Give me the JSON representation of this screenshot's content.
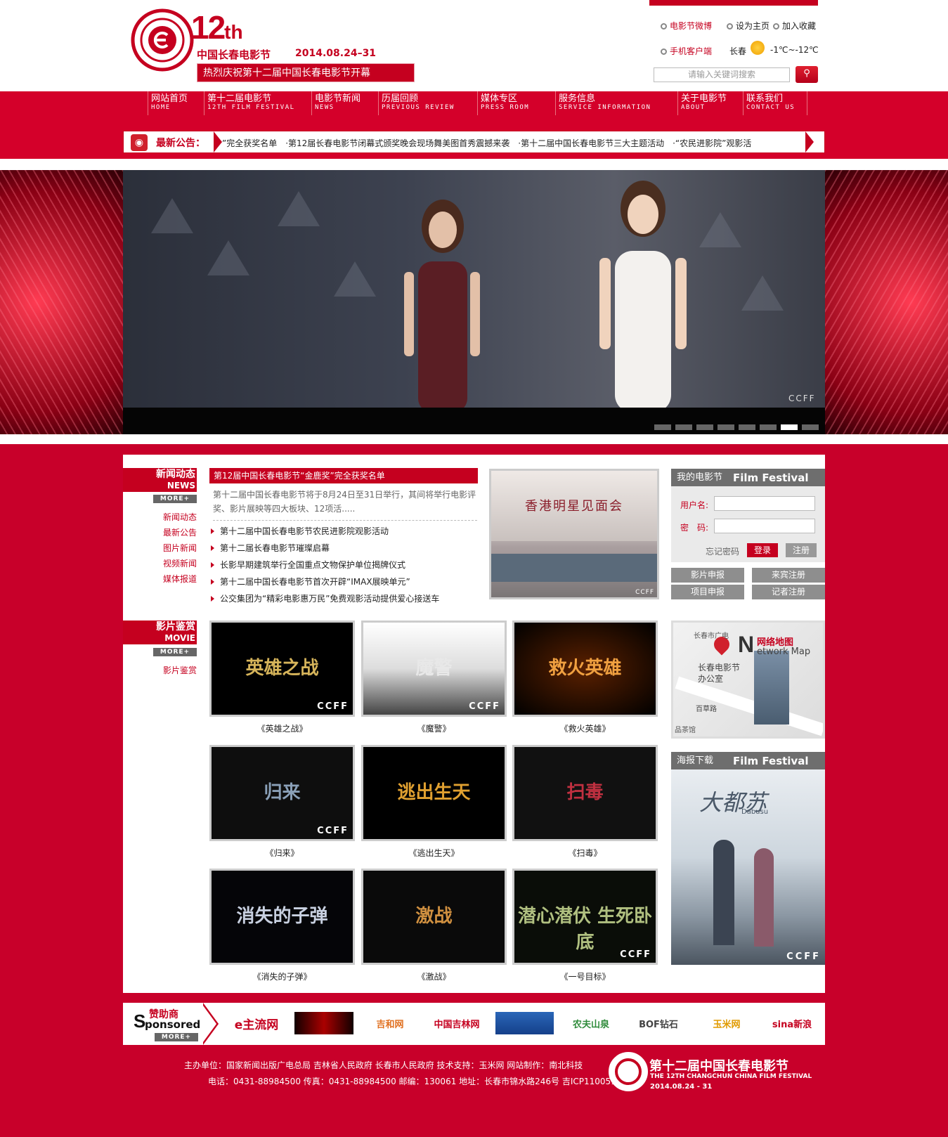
{
  "header": {
    "logo_number": "12",
    "logo_suffix": "th",
    "logo_title": "中国长春电影节",
    "logo_date": "2014.08.24–31",
    "slogan": "热烈庆祝第十二届中国长春电影节开幕",
    "top_links": [
      "电影节微博",
      "设为主页",
      "加入收藏"
    ],
    "mobile_link": "手机客户端",
    "weather_city": "长春",
    "weather_temp": "-1℃~-12℃",
    "search_placeholder": "请输入关键词搜索",
    "search_icon": "search-icon",
    "accent_color": "#c5001f"
  },
  "nav": {
    "items": [
      {
        "cn": "网站首页",
        "en": "HOME"
      },
      {
        "cn": "第十二届电影节",
        "en": "12TH FILM FESTIVAL"
      },
      {
        "cn": "电影节新闻",
        "en": "NEWS"
      },
      {
        "cn": "历届回顾",
        "en": "PREVIOUS REVIEW"
      },
      {
        "cn": "媒体专区",
        "en": "PRESS ROOM"
      },
      {
        "cn": "服务信息",
        "en": "SERVICE INFORMATION"
      },
      {
        "cn": "关于电影节",
        "en": "ABOUT"
      },
      {
        "cn": "联系我们",
        "en": "CONTACT US"
      }
    ]
  },
  "ticker": {
    "label": "最新公告：",
    "text": "”完全获奖名单　·第12届长春电影节闭幕式颁奖晚会现场舞美图首秀震撼来袭　·第十二届中国长春电影节三大主题活动　·“农民进影院”观影活"
  },
  "hero": {
    "watermark": "CCFF",
    "slide_count": 8,
    "active_slide": 7
  },
  "news": {
    "title_cn": "新闻动态",
    "title_en": "NEWS",
    "more": "MORE+",
    "sub_links": [
      "新闻动态",
      "最新公告",
      "图片新闻",
      "视频新闻",
      "媒体报道"
    ],
    "headline": "第12届中国长春电影节“金鹿奖”完全获奖名单",
    "summary": "第十二届中国长春电影节将于8月24日至31日举行，其间将举行电影评奖、影片展映等四大板块、12项活.....",
    "items": [
      "第十二届中国长春电影节农民进影院观影活动",
      "第十二届长春电影节璀璨启幕",
      "长影早期建筑举行全国重点文物保护单位揭牌仪式",
      "第十二届中国长春电影节首次开辟“IMAX展映单元”",
      "公交集团为“精彩电影惠万民”免费观影活动提供爱心接送车"
    ],
    "photo_caption": "香港明星见面会",
    "photo_ccff": "CCFF"
  },
  "member": {
    "title": "我的电影节",
    "title_en": "Film Festival",
    "username_label": "用户名:",
    "password_label": "密　码:",
    "forgot": "忘记密码",
    "login": "登录",
    "register": "注册",
    "buttons": [
      "影片申报",
      "来宾注册",
      "项目申报",
      "记者注册"
    ]
  },
  "movies": {
    "title_cn": "影片鉴赏",
    "title_en": "MOVIE",
    "more": "MORE+",
    "sub_link": "影片鉴赏",
    "items": [
      {
        "poster": "英雄之战",
        "caption": "《英雄之战》",
        "ccff": "CCFF"
      },
      {
        "poster": "魔警",
        "caption": "《魔警》",
        "ccff": "CCFF"
      },
      {
        "poster": "救火英雄",
        "caption": "《救火英雄》",
        "ccff": ""
      },
      {
        "poster": "归来",
        "caption": "《归来》",
        "ccff": "CCFF"
      },
      {
        "poster": "逃出生天",
        "caption": "《逃出生天》",
        "ccff": ""
      },
      {
        "poster": "扫毒",
        "caption": "《扫毒》",
        "ccff": ""
      },
      {
        "poster": "消失的子弹",
        "caption": "《消失的子弹》",
        "ccff": ""
      },
      {
        "poster": "激战",
        "caption": "《激战》",
        "ccff": ""
      },
      {
        "poster": "潜心潜伏 生死卧底",
        "caption": "《一号目标》",
        "ccff": "CCFF"
      }
    ]
  },
  "map": {
    "title_cn": "网络地图",
    "title_en": "etwork Map",
    "letter": "N",
    "office": "长春电影节办公室",
    "top_label": "长春市广电",
    "road": "百草路",
    "bottom": "品茶馆"
  },
  "poster": {
    "title": "海报下载",
    "title_en": "Film Festival",
    "film": "大都苏",
    "film_en": "Dabusu",
    "ccff": "CCFF"
  },
  "sponsors": {
    "title_cn": "赞助商",
    "title_en": "ponsored",
    "letter": "S",
    "more": "MORE+",
    "logos": [
      "e主流网",
      "",
      "吉和网",
      "中国吉林网",
      "",
      "农夫山泉",
      "BOF钻石",
      "玉米网",
      "sina新浪"
    ]
  },
  "footer": {
    "line1": "主办单位：国家新闻出版广电总局  吉林省人民政府  长春市人民政府  技术支持：玉米网  网站制作：南北科技",
    "line2": "电话：0431-88984500  传真：0431-88984500  邮编：130061  地址：长春市锦水路246号  吉ICP11005196",
    "brand_cn": "第十二届中国长春电影节",
    "brand_en": "THE 12TH CHANGCHUN CHINA FILM FESTIVAL",
    "brand_date": "2014.08.24 - 31"
  }
}
